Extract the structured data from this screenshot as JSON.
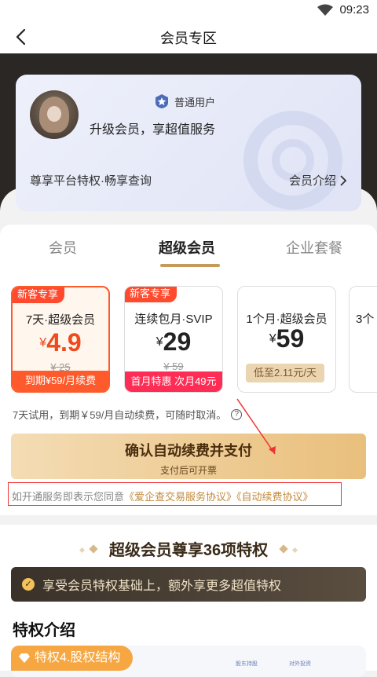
{
  "status_bar": {
    "time": "09:23"
  },
  "header": {
    "title": "会员专区"
  },
  "member_card": {
    "level_label": "普通用户",
    "upgrade_text": "升级会员，享超值服务",
    "subtitle": "尊享平台特权·畅享查询",
    "link_label": "会员介绍"
  },
  "tabs": [
    {
      "label": "会员"
    },
    {
      "label": "超级会员"
    },
    {
      "label": "企业套餐"
    }
  ],
  "plans": [
    {
      "tag": "新客专享",
      "name": "7天·超级会员",
      "currency": "¥",
      "price": "4.9",
      "original": "¥ 25",
      "footer": "到期¥59/月续费"
    },
    {
      "tag": "新客专享",
      "name": "连续包月·SVIP",
      "currency": "¥",
      "price": "29",
      "original": "¥ 59",
      "footer": "首月特惠 次月49元"
    },
    {
      "name": "1个月·超级会员",
      "currency": "¥",
      "price": "59",
      "footer": "低至2.11元/天"
    },
    {
      "name": "3个"
    }
  ],
  "trial_text": "7天试用，到期￥59/月自动续费，可随时取消。",
  "pay_button": {
    "main": "确认自动续费并支付",
    "sub": "支付后可开票"
  },
  "agreement": {
    "prefix": "如开通服务即表示您同意",
    "link1": "《爱企查交易服务协议》",
    "link2": "《自动续费协议》"
  },
  "privileges": {
    "title": "超级会员尊享36项特权",
    "banner_text": "享受会员特权基础上，额外享更多超值特权",
    "intro_title": "特权介绍",
    "feature_tag": "特权4.股权结构",
    "mini_tabs": [
      "股东持股",
      "对外投资"
    ]
  },
  "colors": {
    "accent_orange": "#ff5a2b",
    "gold": "#e9bf7c",
    "dark_band": "#2b2725",
    "link": "#c38a3c"
  }
}
